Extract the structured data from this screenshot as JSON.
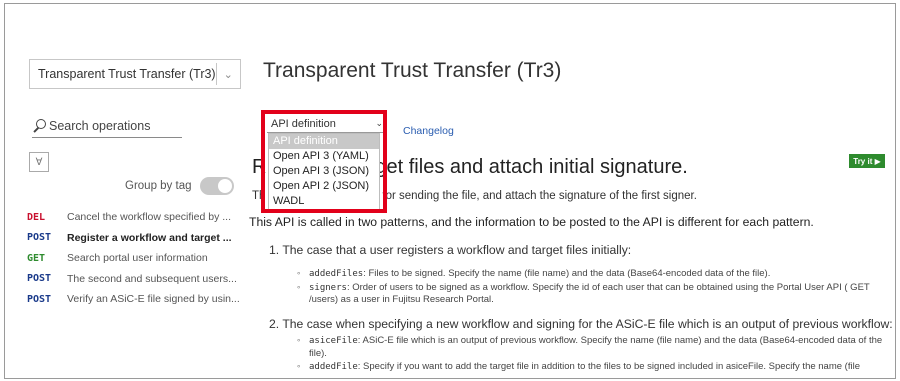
{
  "sidebar": {
    "api_select": "Transparent Trust Transfer (Tr3)",
    "search_placeholder": "Search operations",
    "group_by_tag_label": "Group by tag",
    "operations": [
      {
        "method": "DEL",
        "method_color": "#c8102e",
        "title": "Cancel the workflow specified by ...",
        "active": false
      },
      {
        "method": "POST",
        "method_color": "#1a3a8a",
        "title": "Register a workflow and target ...",
        "active": true
      },
      {
        "method": "GET",
        "method_color": "#2e8b2e",
        "title": "Search portal user information",
        "active": false
      },
      {
        "method": "POST",
        "method_color": "#1a3a8a",
        "title": "The second and subsequent users...",
        "active": false
      },
      {
        "method": "POST",
        "method_color": "#1a3a8a",
        "title": "Verify an ASiC-E file signed by usin...",
        "active": false
      }
    ]
  },
  "main": {
    "title": "Transparent Trust Transfer (Tr3)",
    "definition_select": "API definition",
    "definition_options": [
      "API definition",
      "Open API 3 (YAML)",
      "Open API 3 (JSON)",
      "Open API 2 (JSON)",
      "WADL"
    ],
    "changelog": "Changelog",
    "try_it": "Try it ▶",
    "op_heading": "R                    flow and target files and attach initial signature.",
    "op_sub": "Th                        t file and the workflow for sending the file, and attach the signature of the first signer.",
    "description": "This API is called in two patterns, and the information to be posted to the API is different for each pattern.",
    "case1": "1. The case that a user registers a workflow and target files initially:",
    "case1_bullets": [
      {
        "code": "addedFiles",
        "text": ": Files to be signed. Specify the name (file name) and the data (Base64-encoded data of the file)."
      },
      {
        "code": "signers",
        "text": ": Order of users to be signed as a workflow. Specify the id of each user that can be obtained using the Portal User API ( GET /users) as a user in Fujitsu Research Portal."
      }
    ],
    "case2": "2. The case when specifying a new workflow and signing for the ASiC-E file which is an output of previous workflow:",
    "case2_bullets": [
      {
        "code": "asiceFile",
        "text": ": ASiC-E file which is an output of previous workflow. Specify the name (file name) and the data (Base64-encoded data of the file)."
      },
      {
        "code": "addedFile",
        "text": ": Specify if you want to add the target file in addition to the files to be signed included in asiceFile. Specify the name (file"
      }
    ]
  },
  "colors": {
    "highlight_box": "#e2001a",
    "link": "#2a5db0",
    "try_it_bg": "#2e8b2e"
  }
}
